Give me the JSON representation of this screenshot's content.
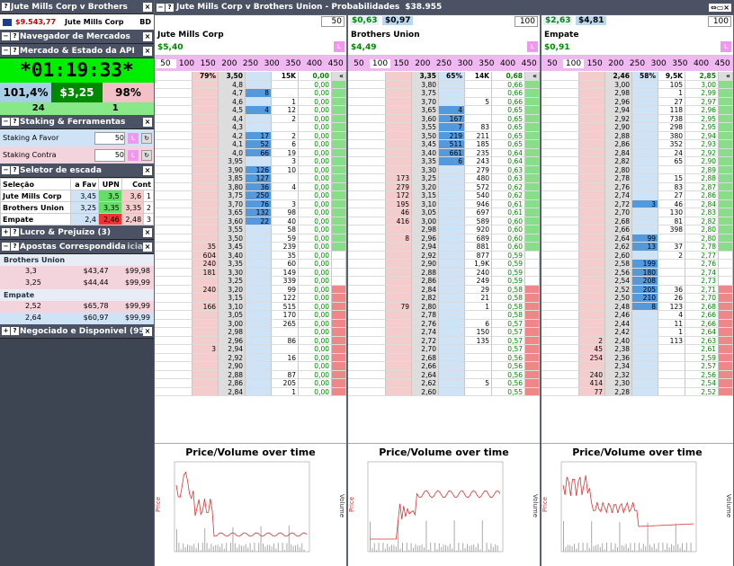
{
  "left": {
    "window_title": "Jute Mills Corp v Brothers",
    "balance": "$9.543,77",
    "market": "Jute Mills Corp",
    "bd": "BD",
    "nav_title": "Navegador de Mercados",
    "api_title": "Mercado & Estado da API",
    "clock": "*01:19:33*",
    "overround_back": "101,4%",
    "matched": "$3,25",
    "overround_lay": "98%",
    "count_a": "24",
    "count_b": "1",
    "staking_title": "Staking & Ferramentas",
    "stake_favor_label": "Staking A Favor",
    "stake_favor": "50",
    "stake_contra_label": "Staking Contra",
    "stake_contra": "50",
    "seletor_title": "Seletor de escada",
    "sel_headers": [
      "Seleção",
      "a Fav",
      "UPN",
      "Cont"
    ],
    "sel_rows": [
      [
        "Jute Mills Corp",
        "3,45",
        "3,5",
        "3,6",
        "1"
      ],
      [
        "Brothers Union",
        "3,25",
        "3,35",
        "3,35",
        "2"
      ],
      [
        "Empate",
        "2,4",
        "2,46",
        "2,48",
        "3"
      ]
    ],
    "lucro_title": "Lucro & Prejuízo (3)",
    "apostas_title": "Apostas Correspondidas",
    "apostas_hint": "icia",
    "apostas": [
      {
        "name": "Brothers Union",
        "rows": [
          [
            "3,3",
            "$43,47",
            "$99,98"
          ],
          [
            "3,25",
            "$44,44",
            "$99,99"
          ]
        ]
      },
      {
        "name": "Empate",
        "rows": [
          [
            "2,52",
            "$65,78",
            "$99,99"
          ],
          [
            "2,64",
            "$60,97",
            "$99,99"
          ]
        ]
      }
    ],
    "negociado_title": "Negociado e Disponivel (95)"
  },
  "main": {
    "title": "Jute Mills Corp v Brothers Union - Probabilidades",
    "total": "$38.955",
    "stake_buttons": [
      "50",
      "100",
      "150",
      "200",
      "250",
      "300",
      "350",
      "400",
      "450"
    ],
    "ladders": [
      {
        "name": "Jute Mills Corp",
        "pl": "$5,40",
        "ltp": "",
        "ltp2": "",
        "stake": "50",
        "head": [
          "",
          "79%",
          "3,50",
          "",
          "15K",
          "0,00"
        ],
        "rows": [
          [
            "",
            "",
            "4,8",
            "",
            "",
            "0,00"
          ],
          [
            "",
            "",
            "4,7",
            "8",
            "",
            "0,00"
          ],
          [
            "",
            "",
            "4,6",
            "",
            "1",
            "0,00"
          ],
          [
            "",
            "",
            "4,5",
            "4",
            "12",
            "0,00"
          ],
          [
            "",
            "",
            "4,4",
            "",
            "2",
            "0,00"
          ],
          [
            "",
            "",
            "4,3",
            "",
            "",
            "0,00"
          ],
          [
            "",
            "",
            "4,2",
            "17",
            "2",
            "0,00"
          ],
          [
            "",
            "",
            "4,1",
            "52",
            "6",
            "0,00"
          ],
          [
            "",
            "",
            "4,0",
            "66",
            "19",
            "0,00"
          ],
          [
            "",
            "",
            "3,95",
            "",
            "3",
            "0,00"
          ],
          [
            "",
            "",
            "3,90",
            "126",
            "10",
            "0,00"
          ],
          [
            "",
            "",
            "3,85",
            "127",
            "",
            "0,00"
          ],
          [
            "",
            "",
            "3,80",
            "36",
            "4",
            "0,00"
          ],
          [
            "",
            "",
            "3,75",
            "250",
            "",
            "0,00"
          ],
          [
            "",
            "",
            "3,70",
            "76",
            "3",
            "0,00"
          ],
          [
            "",
            "",
            "3,65",
            "132",
            "98",
            "0,00"
          ],
          [
            "",
            "",
            "3,60",
            "22",
            "40",
            "0,00"
          ],
          [
            "",
            "",
            "3,55",
            "",
            "58",
            "0,00"
          ],
          [
            "",
            "",
            "3,50",
            "",
            "59",
            "0,00"
          ],
          [
            "",
            "35",
            "3,45",
            "",
            "239",
            "0,00"
          ],
          [
            "",
            "604",
            "3,40",
            "",
            "35",
            "0,00"
          ],
          [
            "",
            "240",
            "3,35",
            "",
            "60",
            "0,00"
          ],
          [
            "",
            "181",
            "3,30",
            "",
            "149",
            "0,00"
          ],
          [
            "",
            "",
            "3,25",
            "",
            "339",
            "0,00"
          ],
          [
            "",
            "240",
            "3,20",
            "",
            "99",
            "0,00"
          ],
          [
            "",
            "",
            "3,15",
            "",
            "122",
            "0,00"
          ],
          [
            "",
            "166",
            "3,10",
            "",
            "515",
            "0,00"
          ],
          [
            "",
            "",
            "3,05",
            "",
            "170",
            "0,00"
          ],
          [
            "",
            "",
            "3,00",
            "",
            "265",
            "0,00"
          ],
          [
            "",
            "",
            "2,98",
            "",
            "",
            "0,00"
          ],
          [
            "",
            "",
            "2,96",
            "",
            "86",
            "0,00"
          ],
          [
            "",
            "3",
            "2,94",
            "",
            "",
            "0,00"
          ],
          [
            "",
            "",
            "2,92",
            "",
            "16",
            "0,00"
          ],
          [
            "",
            "",
            "2,90",
            "",
            "",
            "0,00"
          ],
          [
            "",
            "",
            "2,88",
            "",
            "87",
            "0,00"
          ],
          [
            "",
            "",
            "2,86",
            "",
            "205",
            "0,00"
          ],
          [
            "",
            "",
            "2,84",
            "",
            "1",
            "0,00"
          ]
        ]
      },
      {
        "name": "Brothers Union",
        "pl": "$4,49",
        "ltp": "$0,63",
        "ltp2": "$0,97",
        "stake": "100",
        "head": [
          "",
          "",
          "3,35",
          "65%",
          "14K",
          "0,68"
        ],
        "rows": [
          [
            "",
            "",
            "3,80",
            "",
            "",
            "0,66"
          ],
          [
            "",
            "",
            "3,75",
            "",
            "",
            "0,66"
          ],
          [
            "",
            "",
            "3,70",
            "",
            "5",
            "0,66"
          ],
          [
            "",
            "",
            "3,65",
            "4",
            "",
            "0,65"
          ],
          [
            "",
            "",
            "3,60",
            "167",
            "",
            "0,65"
          ],
          [
            "",
            "",
            "3,55",
            "7",
            "83",
            "0,65"
          ],
          [
            "",
            "",
            "3,50",
            "219",
            "211",
            "0,65"
          ],
          [
            "",
            "",
            "3,45",
            "511",
            "185",
            "0,65"
          ],
          [
            "",
            "",
            "3,40",
            "661",
            "235",
            "0,64"
          ],
          [
            "",
            "",
            "3,35",
            "6",
            "243",
            "0,64"
          ],
          [
            "",
            "",
            "3,30",
            "",
            "279",
            "0,63"
          ],
          [
            "",
            "173",
            "3,25",
            "",
            "480",
            "0,63"
          ],
          [
            "",
            "279",
            "3,20",
            "",
            "572",
            "0,62"
          ],
          [
            "",
            "172",
            "3,15",
            "",
            "540",
            "0,62"
          ],
          [
            "",
            "195",
            "3,10",
            "",
            "946",
            "0,61"
          ],
          [
            "",
            "46",
            "3,05",
            "",
            "697",
            "0,61"
          ],
          [
            "",
            "416",
            "3,00",
            "",
            "589",
            "0,60"
          ],
          [
            "",
            "",
            "2,98",
            "",
            "920",
            "0,60"
          ],
          [
            "",
            "8",
            "2,96",
            "",
            "689",
            "0,60"
          ],
          [
            "",
            "",
            "2,94",
            "",
            "881",
            "0,60"
          ],
          [
            "",
            "",
            "2,92",
            "",
            "877",
            "0,59"
          ],
          [
            "",
            "",
            "2,90",
            "",
            "1,9K",
            "0,59"
          ],
          [
            "",
            "",
            "2,88",
            "",
            "240",
            "0,59"
          ],
          [
            "",
            "",
            "2,86",
            "",
            "249",
            "0,59"
          ],
          [
            "",
            "",
            "2,84",
            "",
            "29",
            "0,58"
          ],
          [
            "",
            "",
            "2,82",
            "",
            "21",
            "0,58"
          ],
          [
            "",
            "79",
            "2,80",
            "",
            "1",
            "0,58"
          ],
          [
            "",
            "",
            "2,78",
            "",
            "",
            "0,58"
          ],
          [
            "",
            "",
            "2,76",
            "",
            "6",
            "0,57"
          ],
          [
            "",
            "",
            "2,74",
            "",
            "150",
            "0,57"
          ],
          [
            "",
            "",
            "2,72",
            "",
            "135",
            "0,57"
          ],
          [
            "",
            "",
            "2,70",
            "",
            "",
            "0,57"
          ],
          [
            "",
            "",
            "2,68",
            "",
            "",
            "0,56"
          ],
          [
            "",
            "",
            "2,66",
            "",
            "",
            "0,56"
          ],
          [
            "",
            "",
            "2,64",
            "",
            "",
            "0,56"
          ],
          [
            "",
            "",
            "2,62",
            "",
            "5",
            "0,56"
          ],
          [
            "",
            "",
            "2,60",
            "",
            "",
            "0,55"
          ]
        ]
      },
      {
        "name": "Empate",
        "pl": "$0,91",
        "ltp": "$2,63",
        "ltp2": "$4,81",
        "stake": "100",
        "head": [
          "",
          "",
          "2,46",
          "58%",
          "9,5K",
          "2,85"
        ],
        "rows": [
          [
            "",
            "",
            "3,00",
            "",
            "105",
            "3,00"
          ],
          [
            "",
            "",
            "2,98",
            "",
            "1",
            "2,99"
          ],
          [
            "",
            "",
            "2,96",
            "",
            "27",
            "2,97"
          ],
          [
            "",
            "",
            "2,94",
            "",
            "118",
            "2,96"
          ],
          [
            "",
            "",
            "2,92",
            "",
            "738",
            "2,95"
          ],
          [
            "",
            "",
            "2,90",
            "",
            "298",
            "2,95"
          ],
          [
            "",
            "",
            "2,88",
            "",
            "380",
            "2,94"
          ],
          [
            "",
            "",
            "2,86",
            "",
            "352",
            "2,93"
          ],
          [
            "",
            "",
            "2,84",
            "",
            "24",
            "2,92"
          ],
          [
            "",
            "",
            "2,82",
            "",
            "65",
            "2,90"
          ],
          [
            "",
            "",
            "2,80",
            "",
            "",
            "2,89"
          ],
          [
            "",
            "",
            "2,78",
            "",
            "15",
            "2,88"
          ],
          [
            "",
            "",
            "2,76",
            "",
            "83",
            "2,87"
          ],
          [
            "",
            "",
            "2,74",
            "",
            "27",
            "2,86"
          ],
          [
            "",
            "",
            "2,72",
            "3",
            "46",
            "2,84"
          ],
          [
            "",
            "",
            "2,70",
            "",
            "130",
            "2,83"
          ],
          [
            "",
            "",
            "2,68",
            "",
            "81",
            "2,82"
          ],
          [
            "",
            "",
            "2,66",
            "",
            "398",
            "2,80"
          ],
          [
            "",
            "",
            "2,64",
            "99",
            "",
            "2,80"
          ],
          [
            "",
            "",
            "2,62",
            "13",
            "37",
            "2,78"
          ],
          [
            "",
            "",
            "2,60",
            "",
            "2",
            "2,77"
          ],
          [
            "",
            "",
            "2,58",
            "199",
            "",
            "2,76"
          ],
          [
            "",
            "",
            "2,56",
            "180",
            "",
            "2,74"
          ],
          [
            "",
            "",
            "2,54",
            "208",
            "",
            "2,73"
          ],
          [
            "",
            "",
            "2,52",
            "205",
            "36",
            "2,71"
          ],
          [
            "",
            "",
            "2,50",
            "210",
            "26",
            "2,70"
          ],
          [
            "",
            "",
            "2,48",
            "8",
            "123",
            "2,68"
          ],
          [
            "",
            "",
            "2,46",
            "",
            "4",
            "2,66"
          ],
          [
            "",
            "",
            "2,44",
            "",
            "11",
            "2,66"
          ],
          [
            "",
            "",
            "2,42",
            "",
            "1",
            "2,64"
          ],
          [
            "",
            "2",
            "2,40",
            "",
            "113",
            "2,63"
          ],
          [
            "",
            "45",
            "2,38",
            "",
            "",
            "2,61"
          ],
          [
            "",
            "254",
            "2,36",
            "",
            "",
            "2,59"
          ],
          [
            "",
            "",
            "2,34",
            "",
            "",
            "2,57"
          ],
          [
            "",
            "240",
            "2,32",
            "",
            "",
            "2,56"
          ],
          [
            "",
            "414",
            "2,30",
            "",
            "",
            "2,54"
          ],
          [
            "",
            "77",
            "2,28",
            "",
            "",
            "2,52"
          ]
        ]
      }
    ],
    "chart_title": "Price/Volume over time",
    "chart_ylabel": "Price",
    "chart_y2label": "Volume"
  },
  "colors": {
    "green": "#00ee00",
    "pink": "#f4cccc",
    "blue": "#cfe3f6",
    "red_line": "#dd3333"
  }
}
